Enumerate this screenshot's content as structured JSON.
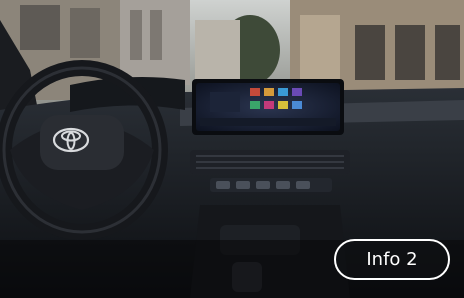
{
  "scene": {
    "image_description_icon": "car-interior-photo",
    "logo_icon": "toyota-logo-icon"
  },
  "overlay": {
    "info_button_label": "Info 2"
  }
}
